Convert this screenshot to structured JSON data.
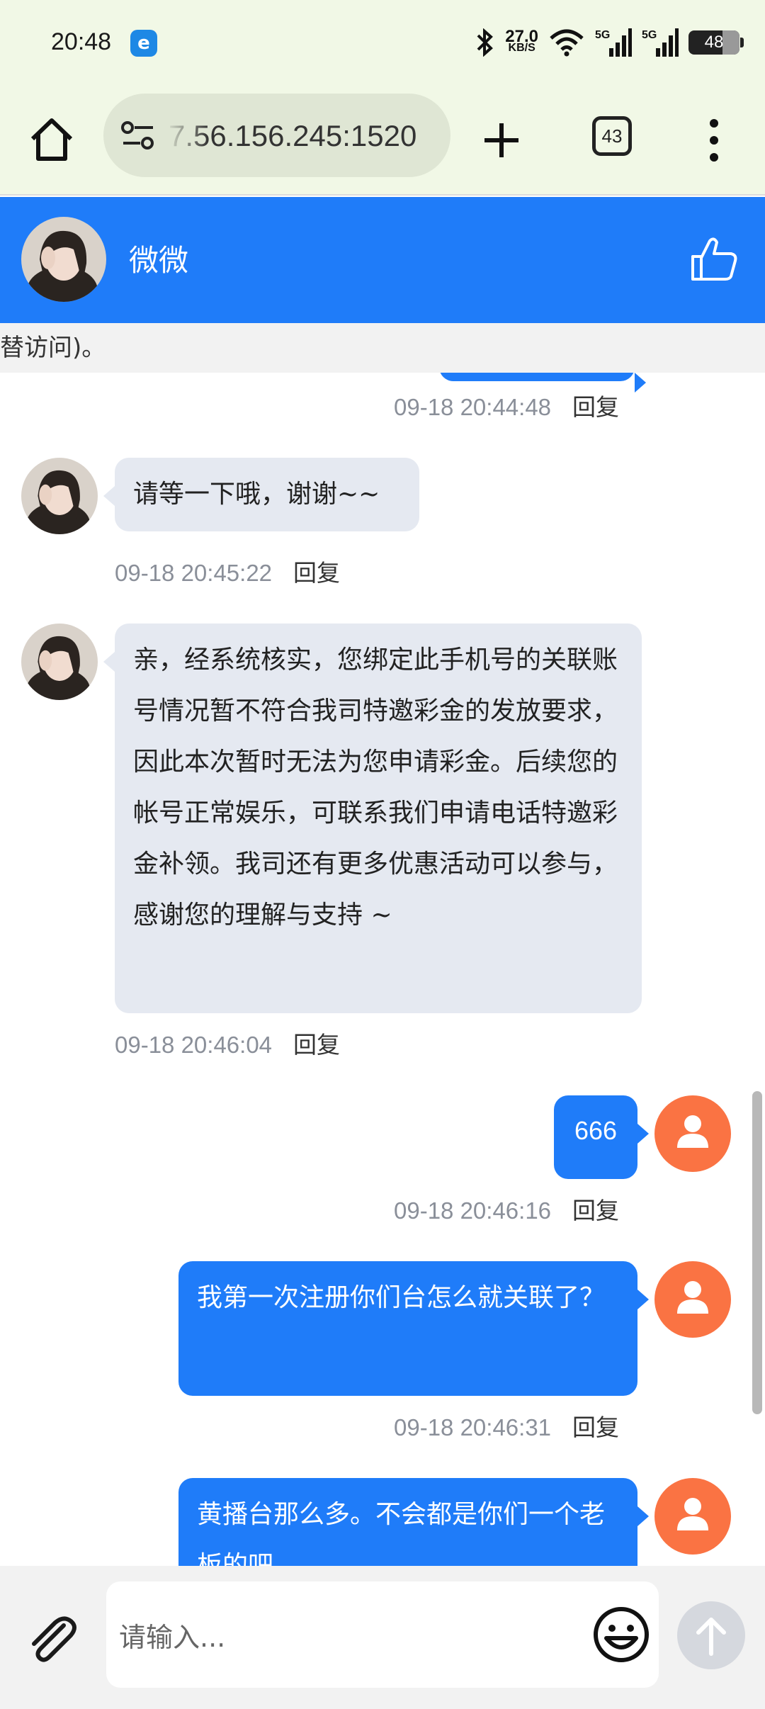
{
  "status_bar": {
    "time": "20:48",
    "network_speed_value": "27.0",
    "network_speed_unit": "KB/S",
    "battery": "48",
    "icons": [
      "browser-app-icon",
      "bluetooth-icon",
      "wifi-icon",
      "5g-signal-icon",
      "5g-signal-icon",
      "battery-icon"
    ]
  },
  "browser": {
    "url": "7.56.156.245:1520",
    "tab_count": "43"
  },
  "chat": {
    "contact_name": "微微",
    "notice": "替访问)。",
    "colors": {
      "header": "#1f7cf9",
      "outgoing_bubble": "#1f7cf9",
      "incoming_bubble": "#e5e9f1",
      "user_avatar": "#fa7343"
    },
    "reply_label": "回复",
    "messages": [
      {
        "direction": "out",
        "text": "",
        "time": "09-18 20:44:48",
        "partial": true
      },
      {
        "direction": "in",
        "text": "请等一下哦，谢谢~~",
        "time": "09-18 20:45:22"
      },
      {
        "direction": "in",
        "text": "亲，经系统核实，您绑定此手机号的关联账号情况暂不符合我司特邀彩金的发放要求，因此本次暂时无法为您申请彩金。后续您的帐号正常娱乐，可联系我们申请电话特邀彩金补领。我司还有更多优惠活动可以参与，感谢您的理解与支持 ~",
        "time": "09-18 20:46:04"
      },
      {
        "direction": "out",
        "text": "666",
        "time": "09-18 20:46:16"
      },
      {
        "direction": "out",
        "text": "我第一次注册你们台怎么就关联了？",
        "time": "09-18 20:46:31"
      },
      {
        "direction": "out",
        "text": "黄播台那么多。不会都是你们一个老板的吧",
        "time": "",
        "partial": true
      }
    ]
  },
  "input": {
    "placeholder": "请输入..."
  }
}
